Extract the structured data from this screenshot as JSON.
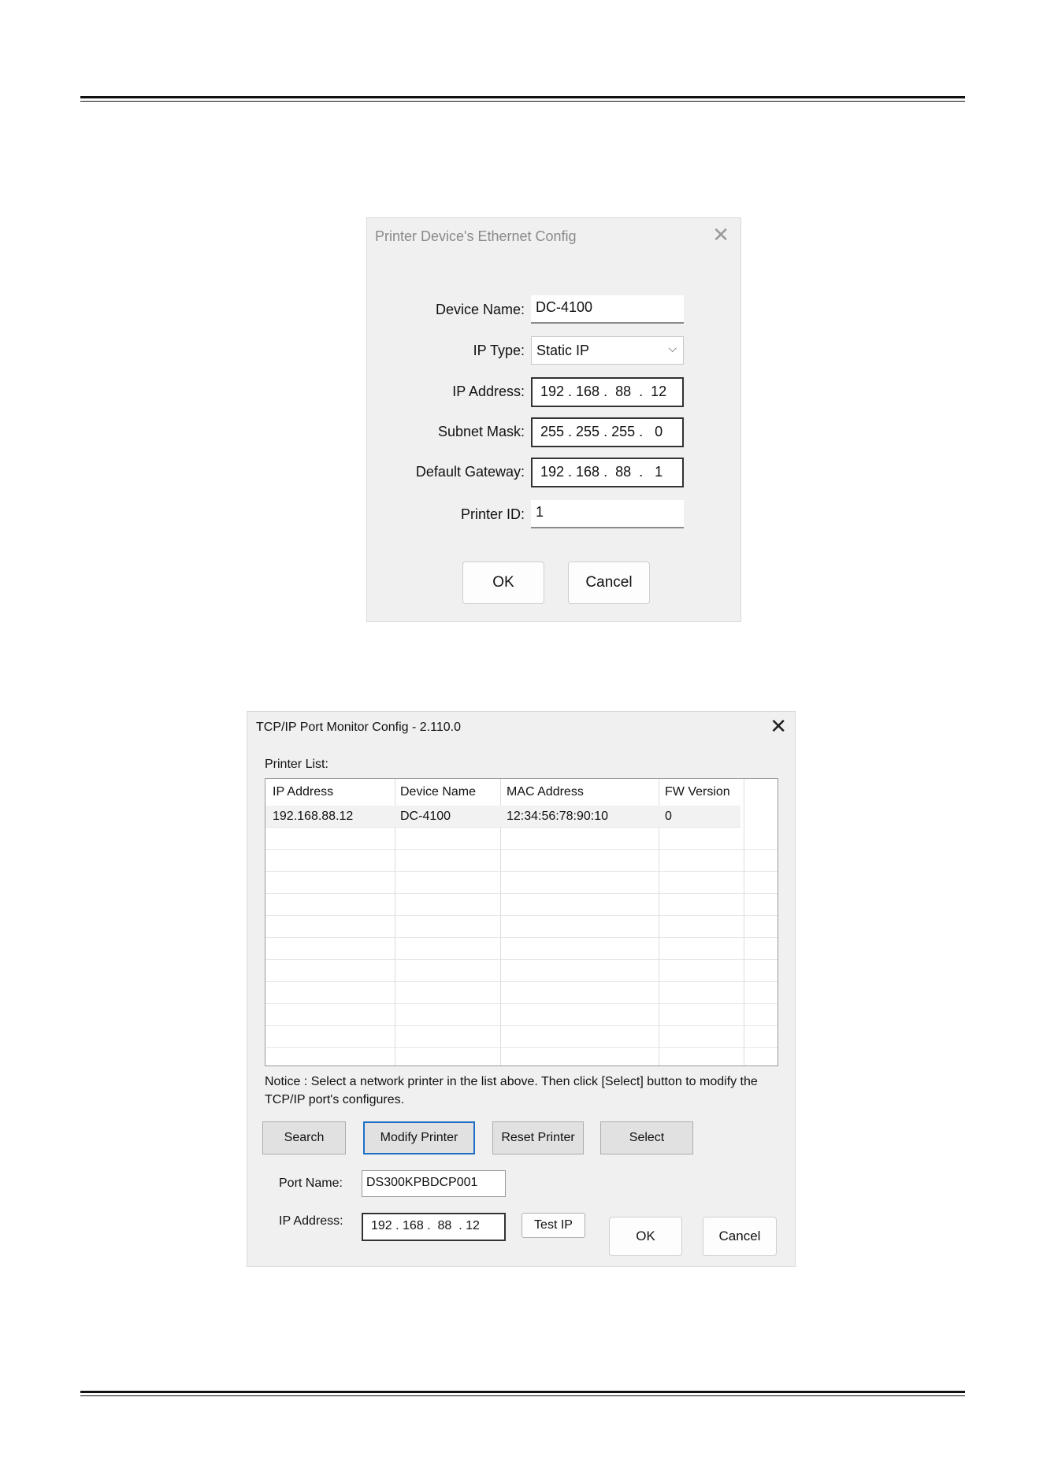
{
  "dialog1": {
    "title": "Printer Device's Ethernet Config",
    "fields": {
      "device_name": {
        "label": "Device Name:",
        "value": "DC-4100"
      },
      "ip_type": {
        "label": "IP Type:",
        "value": "Static IP"
      },
      "ip_address": {
        "label": "IP Address:",
        "value": "192 . 168 .  88  .  12"
      },
      "subnet_mask": {
        "label": "Subnet Mask:",
        "value": "255 . 255 . 255 .   0"
      },
      "default_gateway": {
        "label": "Default Gateway:",
        "value": "192 . 168 .  88  .   1"
      },
      "printer_id": {
        "label": "Printer ID:",
        "value": "1"
      }
    },
    "ok_label": "OK",
    "cancel_label": "Cancel"
  },
  "dialog2": {
    "title": "TCP/IP Port Monitor Config - 2.110.0",
    "printer_list_label": "Printer List:",
    "columns": [
      "IP Address",
      "Device Name",
      "MAC Address",
      "FW Version"
    ],
    "rows": [
      [
        "192.168.88.12",
        "DC-4100",
        "12:34:56:78:90:10",
        "0"
      ]
    ],
    "notice": "Notice : Select a network printer in the list above. Then click [Select] button to modify the TCP/IP port's configures.",
    "buttons": {
      "search": "Search",
      "modify": "Modify Printer",
      "reset": "Reset Printer",
      "select": "Select",
      "test_ip": "Test IP",
      "ok": "OK",
      "cancel": "Cancel"
    },
    "port_name": {
      "label": "Port Name:",
      "value": "DS300KPBDCP001"
    },
    "ip_address": {
      "label": "IP Address:",
      "value": "192 . 168 .  88  . 12"
    }
  }
}
